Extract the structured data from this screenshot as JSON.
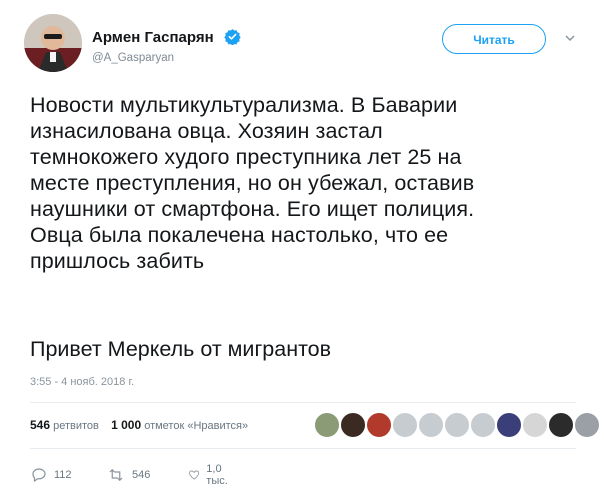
{
  "author": {
    "name": "Армен Гаспарян",
    "handle": "@A_Gasparyan",
    "verified": true
  },
  "follow_label": "Читать",
  "tweet": {
    "text": "Новости мультикультурализма. В Баварии\nизнасилована овца. Хозяин застал\nтемнокожего худого преступника лет 25 на\nместе преступления, но он убежал, оставив\nнаушники от смартфона. Его ищет полиция.\nОвца была покалечена настолько, что ее\nпришлось забить",
    "text_2": "Привет Меркель от мигрантов",
    "timestamp": "3:55 - 4 нояб. 2018 г."
  },
  "stats": {
    "retweets_count": "546",
    "retweets_label": "ретвитов",
    "likes_count": "1 000",
    "likes_label": "отметок «Нравится»"
  },
  "actions": {
    "replies": "112",
    "retweets": "546",
    "likes": "1,0 тыс."
  },
  "colors": {
    "accent": "#1da1f2",
    "muted": "#687681"
  },
  "icons": [
    "verified-badge-icon",
    "chevron-down-icon",
    "reply-icon",
    "retweet-icon",
    "like-icon"
  ]
}
